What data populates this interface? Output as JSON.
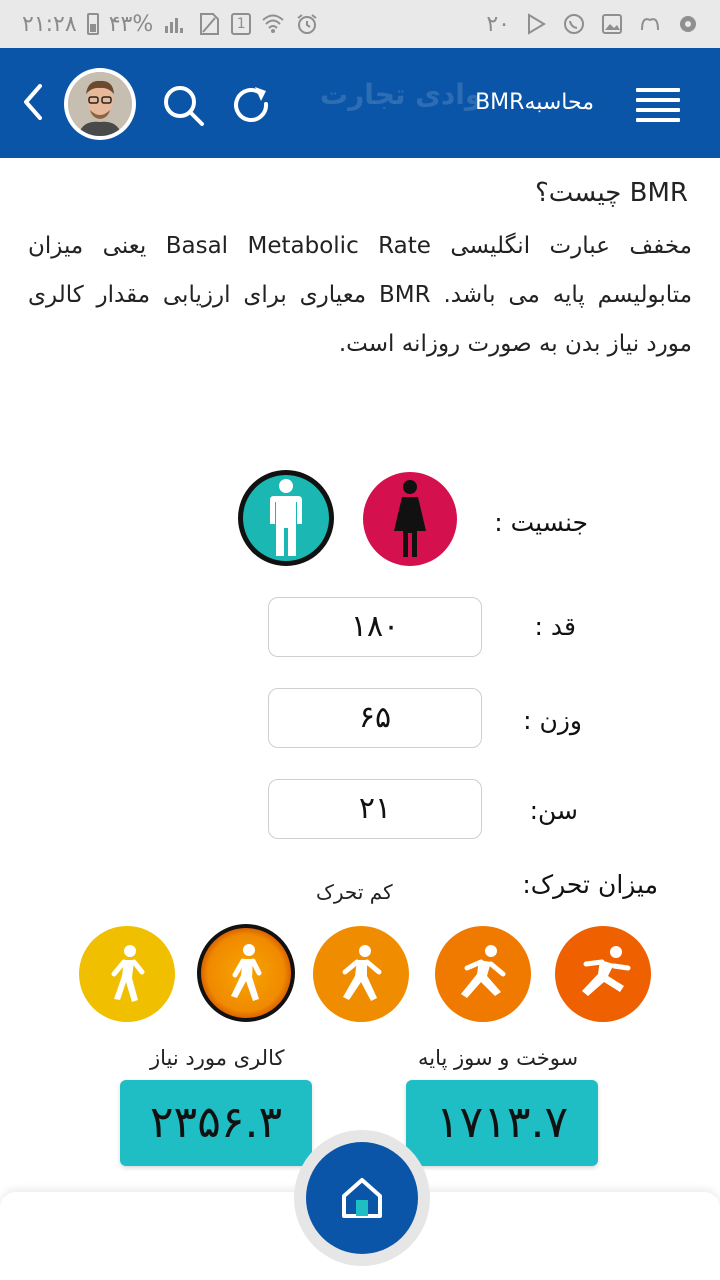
{
  "status_bar": {
    "time": "۲۱:۲۸",
    "battery": "۴۳%",
    "sim_slot": "1",
    "notification_count": "۲۰",
    "icons_left": [
      "battery-icon",
      "signal-icon",
      "sim-icon",
      "sim-slot-icon",
      "wifi-icon",
      "alarm-icon"
    ],
    "icons_right": [
      "play-store-icon",
      "whatsapp-icon",
      "gallery-icon",
      "app-icon",
      "settings-notif-icon"
    ]
  },
  "app_bar": {
    "title": "محاسبهBMR",
    "watermark": "وادی تجارت",
    "color": "#0b55a8"
  },
  "intro": {
    "title": "BMR چیست؟",
    "text": "مخفف عبارت انگلیسی Basal Metabolic Rate یعنی میزان متابولیسم پایه می باشد. BMR معیاری برای ارزیابی مقدار کالری مورد نیاز بدن به صورت روزانه است."
  },
  "form": {
    "gender_label": "جنسیت :",
    "gender_selected": "male",
    "height_label": "قد :",
    "height_value": "۱۸۰",
    "weight_label": "وزن :",
    "weight_value": "۶۵",
    "age_label": "سن:",
    "age_value": "۲۱",
    "activity_label": "میزان تحرک:",
    "activity_selected_label": "کم تحرک",
    "activity_levels": [
      "walk-icon",
      "walk-fast-icon",
      "jog-icon",
      "run-icon",
      "sprint-icon"
    ],
    "activity_colors": [
      "#f0bf00",
      "#f29b00",
      "#f08c00",
      "#f07a00",
      "#ee6000"
    ]
  },
  "results": {
    "calorie_label": "کالری مورد نیاز",
    "calorie_value": "۲۳۵۶.۳",
    "bmr_label": "سوخت و سوز پایه",
    "bmr_value": "۱۷۱۳.۷",
    "box_color": "#1fbec4"
  },
  "nav": {
    "home_icon": "home-icon"
  }
}
